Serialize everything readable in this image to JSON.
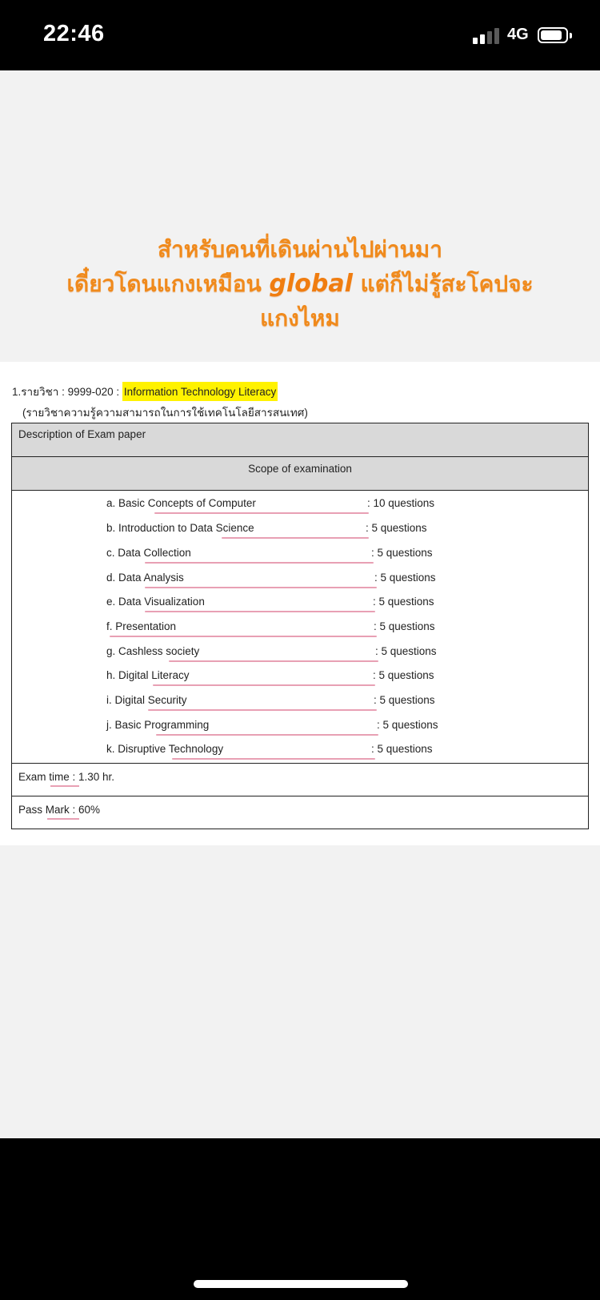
{
  "status_bar": {
    "time": "22:46",
    "network": "4G",
    "signal_bars_filled": 2,
    "signal_bars_total": 4,
    "battery_level": 0.85
  },
  "caption": {
    "line1": "สำหรับคนที่เดินผ่านไปผ่านมา",
    "line2_before": "เดี๋ยวโดนแกงเหมือน ",
    "line2_emphasis": "global",
    "line2_after": " แต่ก็ไม่รู้สะโคปจะ",
    "line3": "แกงไหม",
    "color": "#f08a1c"
  },
  "document": {
    "course_prefix": "1.รายวิชา : 9999-020 : ",
    "course_name": "Information Technology Literacy",
    "course_highlight_color": "#fff200",
    "course_thai": "(รายวิชาความรู้ความสามารถในการใช้เทคโนโลยีสารสนเทศ)",
    "description_header": "Description of Exam paper",
    "scope_header": "Scope of examination",
    "topics": [
      {
        "name": "a. Basic Concepts of Computer",
        "count": ": 10 questions"
      },
      {
        "name": "b. Introduction to Data Science",
        "count": ": 5 questions"
      },
      {
        "name": "c. Data Collection",
        "count": ": 5 questions"
      },
      {
        "name": "d. Data Analysis",
        "count": ": 5 questions"
      },
      {
        "name": "e. Data Visualization",
        "count": ": 5 questions"
      },
      {
        "name": "f. Presentation",
        "count": ": 5 questions"
      },
      {
        "name": "g. Cashless society",
        "count": ": 5 questions"
      },
      {
        "name": "h. Digital Literacy",
        "count": ": 5 questions"
      },
      {
        "name": "i. Digital Security",
        "count": ": 5 questions"
      },
      {
        "name": "j. Basic Programming",
        "count": ": 5 questions"
      },
      {
        "name": "k. Disruptive Technology",
        "count": ": 5 questions"
      }
    ],
    "exam_time": "Exam time : 1.30 hr.",
    "pass_mark": "Pass Mark : 60%",
    "annotation_color": "#e8a0b4"
  }
}
